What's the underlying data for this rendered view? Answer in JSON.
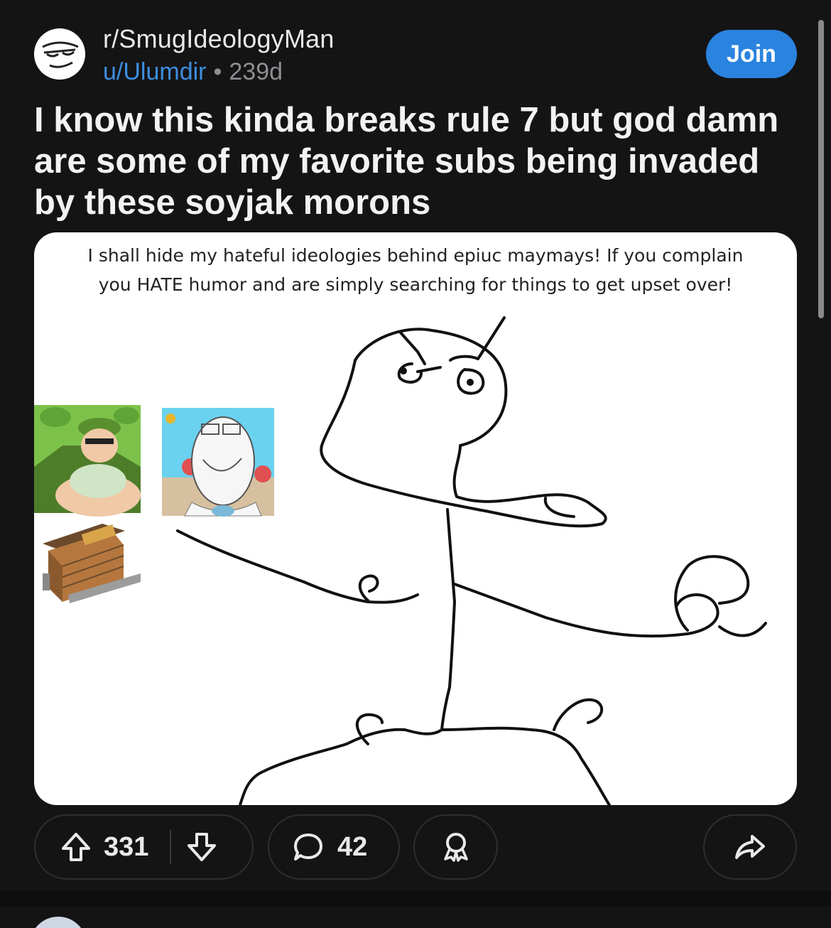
{
  "post": {
    "subreddit": "r/SmugIdeologyMan",
    "author": "u/Ulumdir",
    "separator": "•",
    "age": "239d",
    "join_label": "Join",
    "title": "I know this kinda breaks rule 7 but god damn are some of my favorite subs being invaded by these soyjak morons"
  },
  "image": {
    "caption_line1": "I shall hide my hateful ideologies behind epiuc maymays! If you complain",
    "caption_line2": "you HATE humor and are simply searching for things to get upset over!"
  },
  "actions": {
    "upvotes": "331",
    "comments": "42"
  },
  "icons": {
    "upvote": "arrow-up-icon",
    "downvote": "arrow-down-icon",
    "comment": "speech-bubble-icon",
    "award": "award-ribbon-icon",
    "share": "share-arrow-icon"
  },
  "colors": {
    "background": "#141415",
    "join_button": "#2a83df",
    "username": "#3d8fe0"
  }
}
